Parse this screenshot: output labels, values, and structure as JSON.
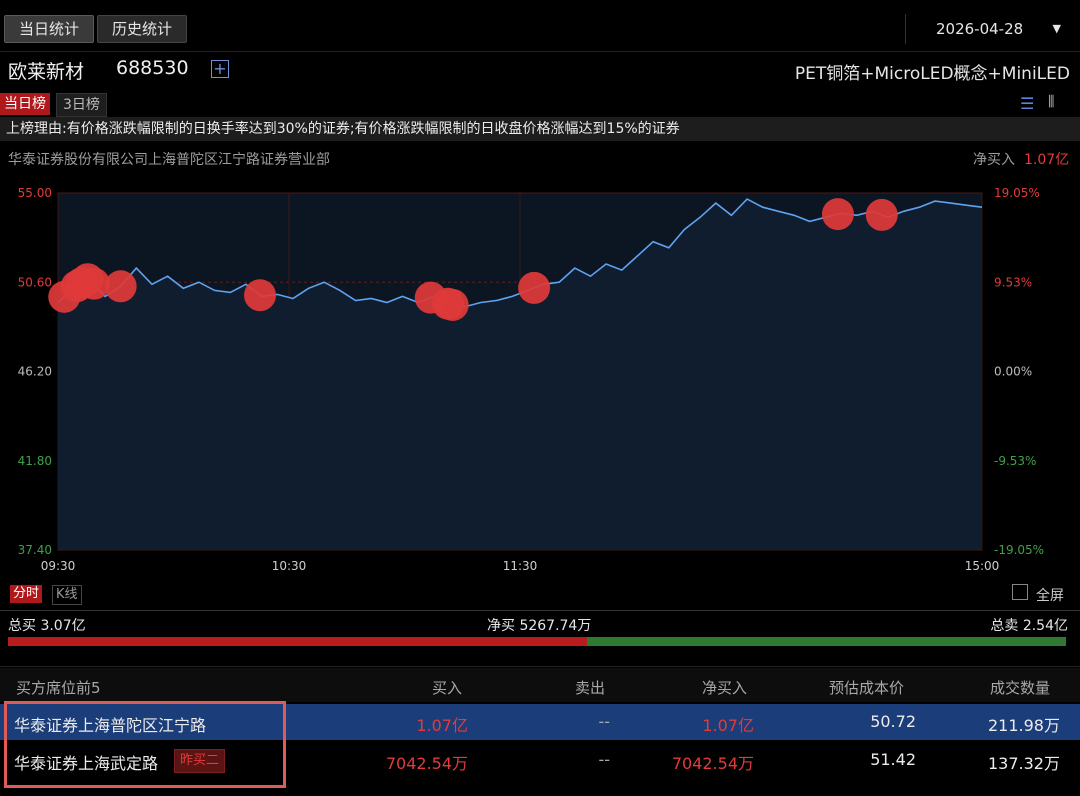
{
  "tabs": {
    "today": "当日统计",
    "history": "历史统计"
  },
  "date_select": {
    "value": "2026-04-28"
  },
  "stock": {
    "name": "欧莱新材",
    "code": "688530",
    "concept": "PET铜箔+MicroLED概念+MiniLED"
  },
  "rank_tabs": {
    "today": "当日榜",
    "three_day": "3日榜"
  },
  "reason": "上榜理由:有价格涨跌幅限制的日换手率达到30%的证券;有价格涨跌幅限制的日收盘价格涨幅达到15%的证券",
  "broker_header": {
    "name": "华泰证券股份有限公司上海普陀区江宁路证券营业部",
    "net_label": "净买入",
    "net_value": "1.07亿"
  },
  "chart_data": {
    "type": "line",
    "y_left_ticks": [
      "55.00",
      "50.60",
      "46.20",
      "41.80",
      "37.40"
    ],
    "y_right_ticks": [
      "19.05%",
      "9.53%",
      "0.00%",
      "-9.53%",
      "-19.05%"
    ],
    "x_ticks": [
      "09:30",
      "10:30",
      "11:30",
      "15:00"
    ],
    "ylim": [
      37.4,
      55.0
    ],
    "prev_close": 46.2,
    "series": [
      {
        "values": [
          49.6,
          50.3,
          50.8,
          49.9,
          50.4,
          51.3,
          50.5,
          50.9,
          50.3,
          50.6,
          50.2,
          50.1,
          50.5,
          49.9,
          50.0,
          49.8,
          50.3,
          50.6,
          50.2,
          49.7,
          49.8,
          49.6,
          49.9,
          49.6,
          49.9,
          49.5,
          49.4,
          49.6,
          49.7,
          49.9,
          50.2,
          50.5,
          50.6,
          51.3,
          50.9,
          51.5,
          51.2,
          51.9,
          52.6,
          52.3,
          53.2,
          53.8,
          54.5,
          53.9,
          54.7,
          54.3,
          54.1,
          53.9,
          53.6,
          53.8,
          54.0,
          53.9,
          54.1,
          53.8,
          54.1,
          54.3,
          54.6,
          54.5,
          54.4,
          54.3
        ]
      }
    ],
    "trade_markers": [
      0.4,
      1.2,
      1.5,
      1.9,
      2.3,
      4.0,
      12.9,
      23.8,
      24.9,
      25.2,
      30.4,
      49.8,
      52.6
    ]
  },
  "mode_tabs": {
    "fenshi": "分时",
    "kline": "K线"
  },
  "fullscreen": "全屏",
  "totals": {
    "buy": "总买 3.07亿",
    "net": "净买 5267.74万",
    "sell": "总卖 2.54亿",
    "buy_ratio": 0.547
  },
  "table": {
    "headers": [
      "买方席位前5",
      "买入",
      "卖出",
      "净买入",
      "预估成本价",
      "成交数量"
    ],
    "rows": [
      {
        "name": "华泰证券上海普陀区江宁路",
        "tag": "",
        "buy": "1.07亿",
        "sell": "--",
        "net": "1.07亿",
        "cost": "50.72",
        "volume": "211.98万"
      },
      {
        "name": "华泰证券上海武定路",
        "tag": "昨买二",
        "buy": "7042.54万",
        "sell": "--",
        "net": "7042.54万",
        "cost": "51.42",
        "volume": "137.32万"
      }
    ]
  },
  "colors": {
    "up": "#e23b3b",
    "line": "#5fa2f0",
    "marker": "#e03a3a",
    "down": "#2f7a32"
  }
}
